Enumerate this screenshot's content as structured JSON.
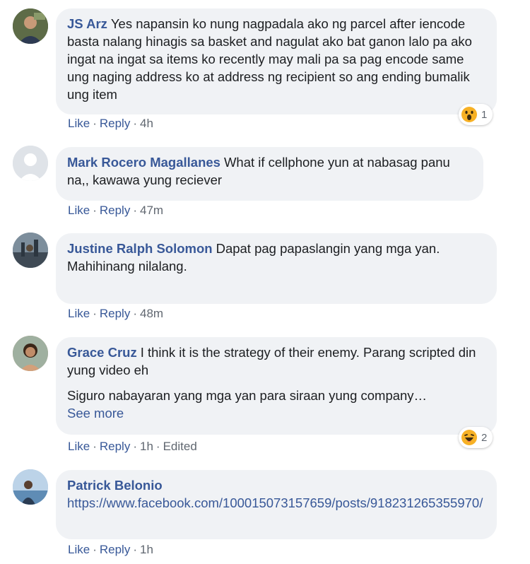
{
  "comments": [
    {
      "author": "JS Arz",
      "text": "Yes napansin ko nung nagpadala ako ng parcel after iencode basta nalang hinagis sa basket and nagulat ako bat ganon lalo pa ako ingat na ingat sa items ko recently may mali pa sa pag encode same ung naging address ko at address ng recipient so ang ending bumalik ung item",
      "actions": {
        "like": "Like",
        "reply": "Reply",
        "time": "4h"
      },
      "reaction": {
        "icon": "wow-reaction-icon",
        "count": "1"
      }
    },
    {
      "author": "Mark Rocero Magallanes",
      "text": "What if cellphone yun at nabasag panu na,, kawawa yung reciever",
      "actions": {
        "like": "Like",
        "reply": "Reply",
        "time": "47m"
      }
    },
    {
      "author": "Justine Ralph Solomon",
      "text": "Dapat pag papaslangin yang mga yan.\nMahihinang nilalang.",
      "actions": {
        "like": "Like",
        "reply": "Reply",
        "time": "48m"
      }
    },
    {
      "author": "Grace Cruz",
      "text": "I think it is the strategy of their enemy. Parang scripted din yung video eh",
      "text2": "Siguro nabayaran yang mga yan para siraan yung company…",
      "see_more": "See more",
      "actions": {
        "like": "Like",
        "reply": "Reply",
        "time": "1h",
        "edited": "Edited"
      },
      "reaction": {
        "icon": "haha-reaction-icon",
        "count": "2"
      }
    },
    {
      "author": "Patrick Belonio",
      "link": "https://www.facebook.com/100015073157659/posts/918231265355970/",
      "actions": {
        "like": "Like",
        "reply": "Reply",
        "time": "1h"
      }
    }
  ],
  "separator": "·",
  "colors": {
    "author": "#385898",
    "bubble": "#f0f2f5",
    "meta": "#606770",
    "reaction": "#f7b125"
  }
}
